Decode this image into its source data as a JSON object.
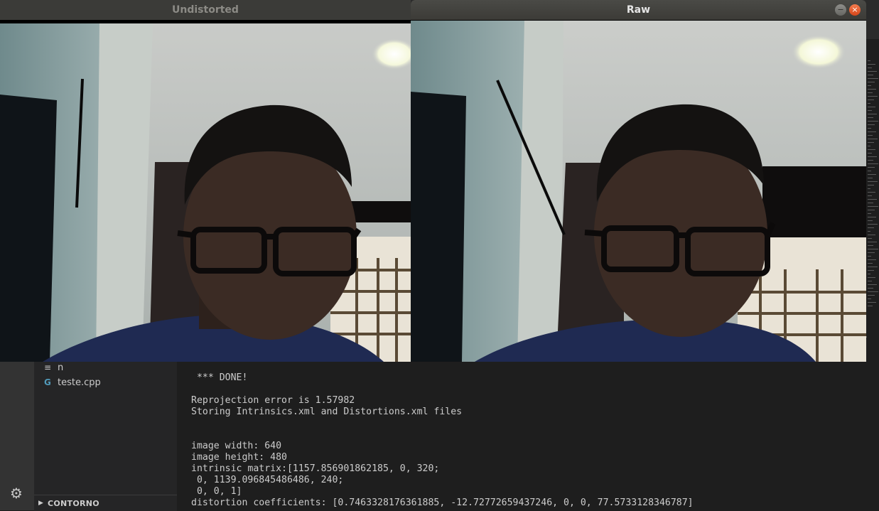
{
  "windows": {
    "undistorted": {
      "title": "Undistorted"
    },
    "raw": {
      "title": "Raw",
      "minimize_glyph": "−",
      "close_glyph": "×"
    }
  },
  "explorer": {
    "files": [
      {
        "name": "n",
        "icon": "text-file-icon",
        "glyph": "≡"
      },
      {
        "name": "teste.cpp",
        "icon": "cpp-file-icon",
        "glyph": "G"
      }
    ],
    "outline_section": "CONTORNO",
    "chevron_glyph": "▶"
  },
  "activity_bar": {
    "settings_icon": "gear-icon",
    "gear_glyph": "⚙"
  },
  "terminal": {
    "lines": [
      " *** DONE!",
      "",
      "Reprojection error is 1.57982",
      "Storing Intrinsics.xml and Distortions.xml files",
      "",
      "",
      "image width: 640",
      "image height: 480",
      "intrinsic matrix:[1157.856901862185, 0, 320;",
      " 0, 1139.096845486486, 240;",
      " 0, 0, 1]",
      "distortion coefficients: [0.7463328176361885, -12.72772659437246, 0, 0, 77.5733128346787]"
    ]
  },
  "colors": {
    "editor_bg": "#1e1e1e",
    "sidebar_bg": "#252526",
    "activity_bar_bg": "#333333",
    "terminal_text": "#cccccc",
    "close_button": "#e25724"
  }
}
